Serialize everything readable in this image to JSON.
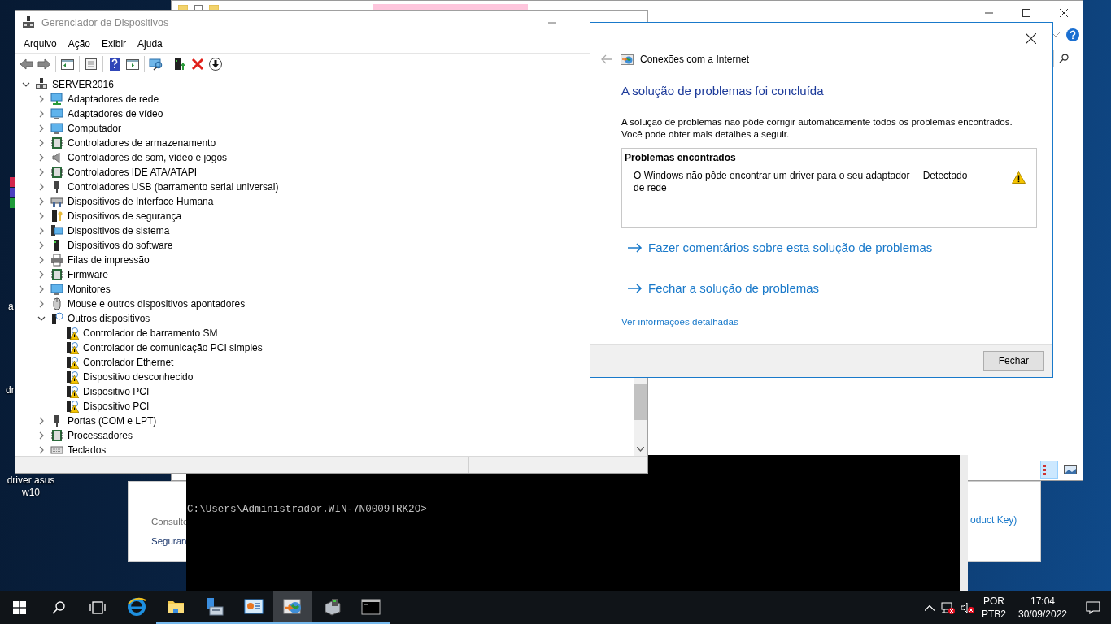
{
  "desktop": {
    "labels": [
      "a",
      "dr",
      "driver asus w10"
    ]
  },
  "background_window": {
    "texts": [
      "Consulte",
      "Seguran",
      "oduct Key)"
    ]
  },
  "console": {
    "prompt": "C:\\Users\\Administrador.WIN-7N0009TRK2O>"
  },
  "device_manager": {
    "title": "Gerenciador de Dispositivos",
    "menu": [
      "Arquivo",
      "Ação",
      "Exibir",
      "Ajuda"
    ],
    "tree": {
      "label": "SERVER2016",
      "expanded": true,
      "children": [
        {
          "label": "Adaptadores de rede",
          "expanded": false,
          "warning": false
        },
        {
          "label": "Adaptadores de vídeo",
          "expanded": false,
          "warning": false
        },
        {
          "label": "Computador",
          "expanded": false,
          "warning": false
        },
        {
          "label": "Controladores de armazenamento",
          "expanded": false,
          "warning": false
        },
        {
          "label": "Controladores de som, vídeo e jogos",
          "expanded": false,
          "warning": false
        },
        {
          "label": "Controladores IDE ATA/ATAPI",
          "expanded": false,
          "warning": false
        },
        {
          "label": "Controladores USB (barramento serial universal)",
          "expanded": false,
          "warning": false
        },
        {
          "label": "Dispositivos de Interface Humana",
          "expanded": false,
          "warning": false
        },
        {
          "label": "Dispositivos de segurança",
          "expanded": false,
          "warning": false
        },
        {
          "label": "Dispositivos de sistema",
          "expanded": false,
          "warning": false
        },
        {
          "label": "Dispositivos do software",
          "expanded": false,
          "warning": false
        },
        {
          "label": "Filas de impressão",
          "expanded": false,
          "warning": false
        },
        {
          "label": "Firmware",
          "expanded": false,
          "warning": false
        },
        {
          "label": "Monitores",
          "expanded": false,
          "warning": false
        },
        {
          "label": "Mouse e outros dispositivos apontadores",
          "expanded": false,
          "warning": false
        },
        {
          "label": "Outros dispositivos",
          "expanded": true,
          "warning": false,
          "children": [
            {
              "label": "Controlador de barramento SM",
              "warning": true
            },
            {
              "label": "Controlador de comunicação PCI simples",
              "warning": true
            },
            {
              "label": "Controlador Ethernet",
              "warning": true
            },
            {
              "label": "Dispositivo desconhecido",
              "warning": true
            },
            {
              "label": "Dispositivo PCI",
              "warning": true
            },
            {
              "label": "Dispositivo PCI",
              "warning": true
            }
          ]
        },
        {
          "label": "Portas (COM e LPT)",
          "expanded": false,
          "warning": false
        },
        {
          "label": "Processadores",
          "expanded": false,
          "warning": false
        },
        {
          "label": "Teclados",
          "expanded": false,
          "warning": false
        }
      ]
    }
  },
  "troubleshooter": {
    "breadcrumb": "Conexões com a Internet",
    "heading": "A solução de problemas foi concluída",
    "description": "A solução de problemas não pôde corrigir automaticamente todos os problemas encontrados. Você pode obter mais detalhes a seguir.",
    "problems": {
      "title": "Problemas encontrados",
      "items": [
        {
          "text": "O Windows não pôde encontrar um driver para o seu adaptador de rede",
          "status": "Detectado"
        }
      ]
    },
    "links": [
      "Fazer comentários sobre esta solução de problemas",
      "Fechar a solução de problemas"
    ],
    "details_link": "Ver informações detalhadas",
    "button": "Fechar"
  },
  "taskbar": {
    "apps": [
      {
        "running": false,
        "selected": false
      },
      {
        "running": true,
        "selected": false
      },
      {
        "running": true,
        "selected": false
      },
      {
        "running": true,
        "selected": false
      },
      {
        "running": true,
        "selected": true
      },
      {
        "running": true,
        "selected": false
      },
      {
        "running": true,
        "selected": false
      }
    ],
    "language": "POR",
    "layout": "PTB2",
    "time": "17:04",
    "date": "30/09/2022"
  }
}
